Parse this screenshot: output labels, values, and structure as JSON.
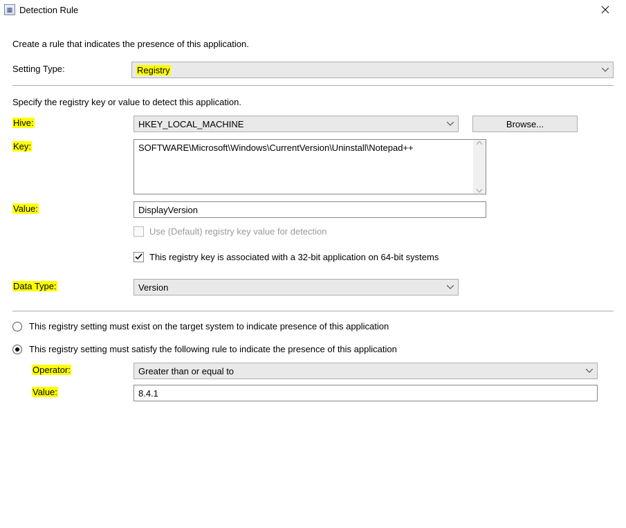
{
  "titlebar": {
    "title": "Detection Rule",
    "close_label": "Close"
  },
  "intro": "Create a rule that indicates the presence of this application.",
  "setting_type": {
    "label": "Setting Type:",
    "value": "Registry"
  },
  "section2_intro": "Specify the registry key or value to detect this application.",
  "hive": {
    "label": "Hive:",
    "value": "HKEY_LOCAL_MACHINE",
    "browse_label": "Browse..."
  },
  "key": {
    "label": "Key:",
    "value": "SOFTWARE\\Microsoft\\Windows\\CurrentVersion\\Uninstall\\Notepad++"
  },
  "value_field": {
    "label": "Value:",
    "value": "DisplayVersion",
    "use_default_label": "Use (Default) registry key value for detection",
    "assoc_32bit_label": "This registry key is associated with a 32-bit application on 64-bit systems"
  },
  "data_type": {
    "label": "Data Type:",
    "value": "Version"
  },
  "rule_radio": {
    "opt_exist": "This registry setting must exist on the target system to indicate presence of this application",
    "opt_satisfy": "This registry setting must satisfy the following rule to indicate the presence of this application"
  },
  "operator": {
    "label": "Operator:",
    "value": "Greater than or equal to"
  },
  "rule_value": {
    "label": "Value:",
    "value": "8.4.1"
  }
}
